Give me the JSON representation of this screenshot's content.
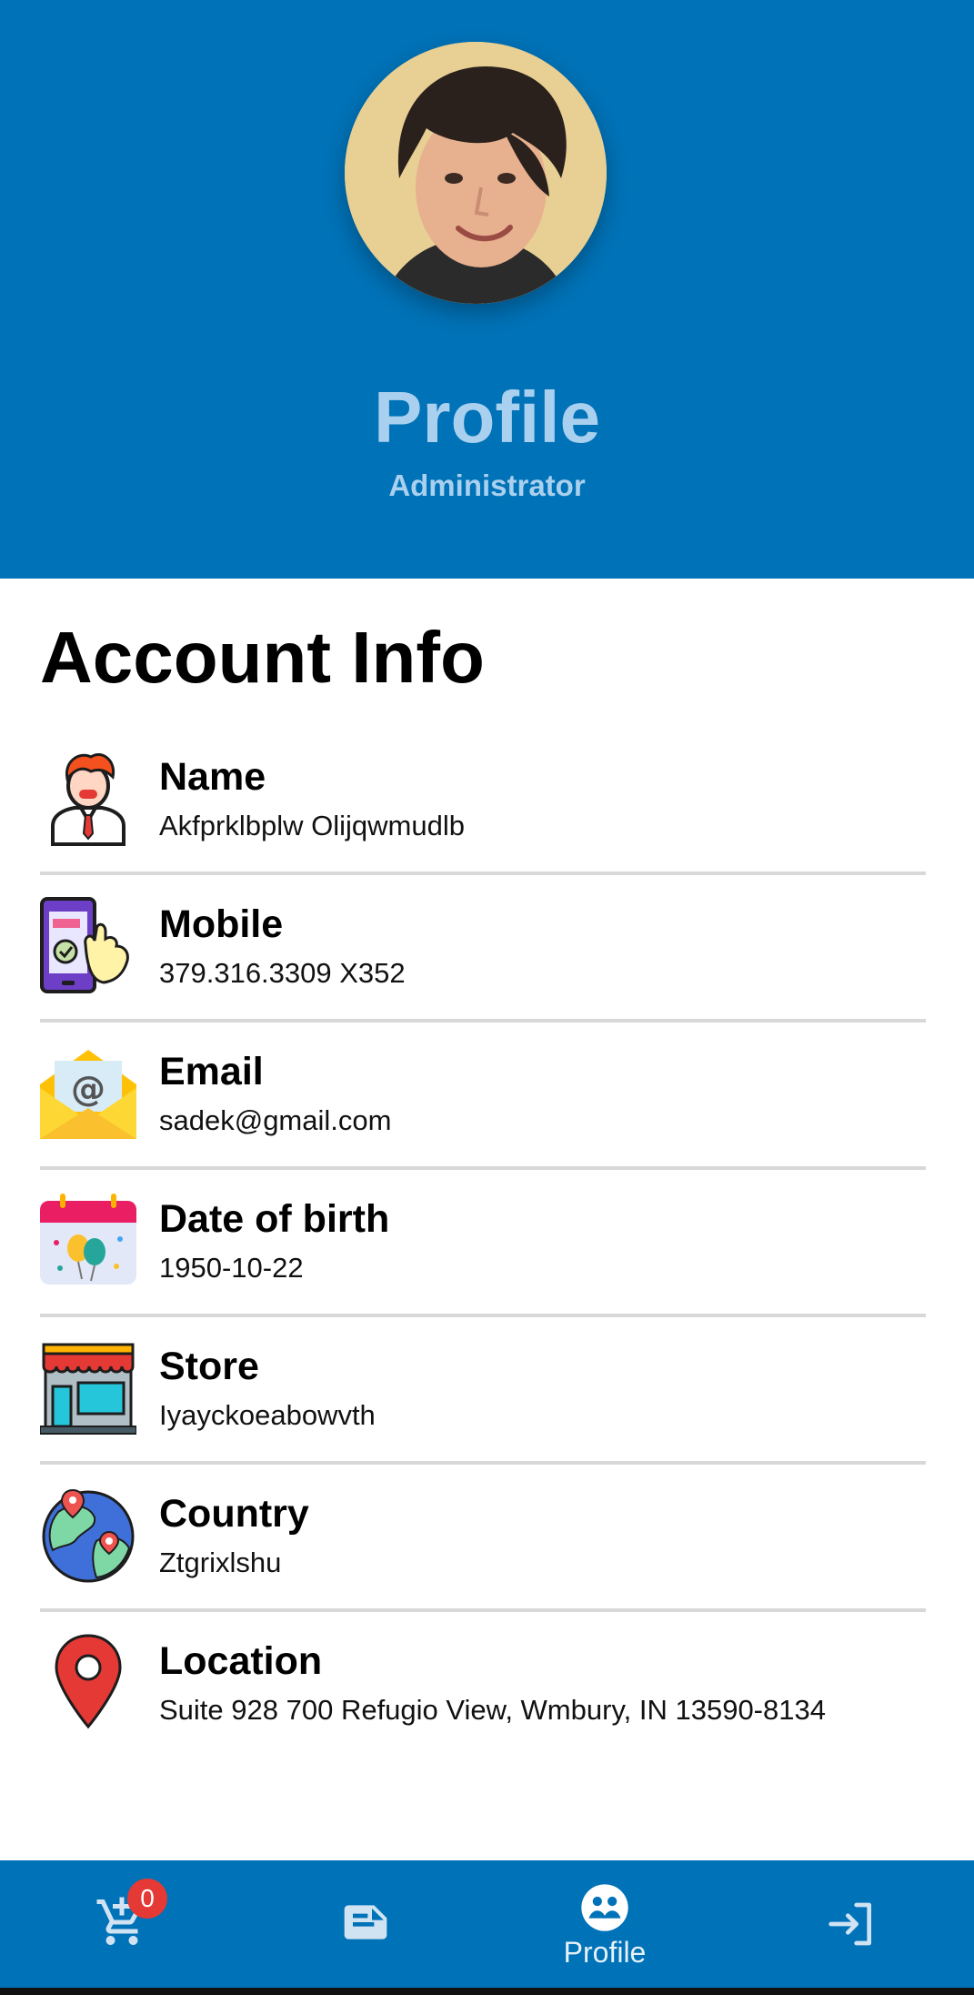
{
  "header": {
    "title": "Profile",
    "role": "Administrator",
    "background": "#0072b7"
  },
  "account": {
    "title": "Account Info",
    "items": [
      {
        "label": "Name",
        "value": "Akfprklbplw Olijqwmudlb",
        "icon": "person-icon"
      },
      {
        "label": "Mobile",
        "value": "379.316.3309 X352",
        "icon": "mobile-icon"
      },
      {
        "label": "Email",
        "value": "sadek@gmail.com",
        "icon": "email-icon"
      },
      {
        "label": "Date of birth",
        "value": "1950-10-22",
        "icon": "calendar-icon"
      },
      {
        "label": "Store",
        "value": "Iyayckoeabowvth",
        "icon": "store-icon"
      },
      {
        "label": "Country",
        "value": "Ztgrixlshu",
        "icon": "globe-icon"
      },
      {
        "label": "Location",
        "value": "Suite 928 700 Refugio View, Wmbury, IN 13590-8134",
        "icon": "location-pin-icon"
      }
    ]
  },
  "bottom_nav": {
    "cart_badge": "0",
    "items": [
      {
        "id": "cart",
        "icon": "cart-add-icon"
      },
      {
        "id": "notes",
        "icon": "note-icon"
      },
      {
        "id": "profile",
        "icon": "profile-icon",
        "label": "Profile",
        "active": true
      },
      {
        "id": "logout",
        "icon": "logout-icon"
      }
    ]
  }
}
